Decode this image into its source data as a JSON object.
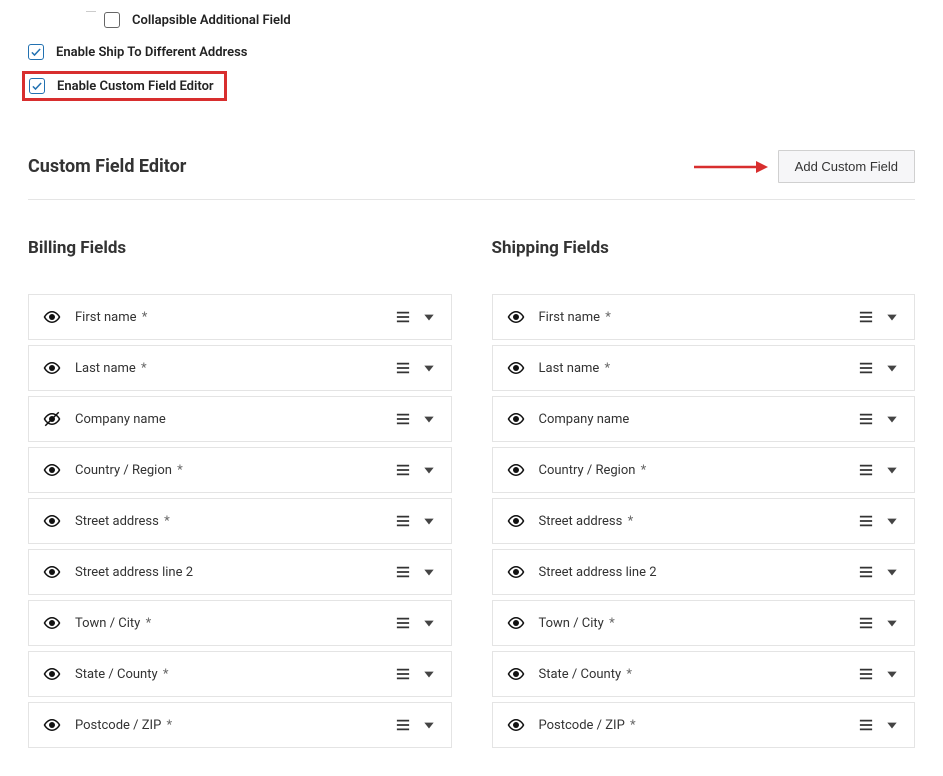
{
  "options": {
    "collapsible": {
      "label": "Collapsible Additional Field",
      "checked": false
    },
    "ship_different": {
      "label": "Enable Ship To Different Address",
      "checked": true
    },
    "custom_editor": {
      "label": "Enable Custom Field Editor",
      "checked": true
    }
  },
  "editor": {
    "title": "Custom Field Editor",
    "add_button": "Add Custom Field"
  },
  "columns": {
    "billing_title": "Billing Fields",
    "shipping_title": "Shipping Fields"
  },
  "billing_fields": [
    {
      "label": "First name",
      "required": true,
      "visible": true
    },
    {
      "label": "Last name",
      "required": true,
      "visible": true
    },
    {
      "label": "Company name",
      "required": false,
      "visible": false
    },
    {
      "label": "Country / Region",
      "required": true,
      "visible": true
    },
    {
      "label": "Street address",
      "required": true,
      "visible": true
    },
    {
      "label": "Street address line 2",
      "required": false,
      "visible": true
    },
    {
      "label": "Town / City",
      "required": true,
      "visible": true
    },
    {
      "label": "State / County",
      "required": true,
      "visible": true
    },
    {
      "label": "Postcode / ZIP",
      "required": true,
      "visible": true
    }
  ],
  "shipping_fields": [
    {
      "label": "First name",
      "required": true,
      "visible": true
    },
    {
      "label": "Last name",
      "required": true,
      "visible": true
    },
    {
      "label": "Company name",
      "required": false,
      "visible": true
    },
    {
      "label": "Country / Region",
      "required": true,
      "visible": true
    },
    {
      "label": "Street address",
      "required": true,
      "visible": true
    },
    {
      "label": "Street address line 2",
      "required": false,
      "visible": true
    },
    {
      "label": "Town / City",
      "required": true,
      "visible": true
    },
    {
      "label": "State / County",
      "required": true,
      "visible": true
    },
    {
      "label": "Postcode / ZIP",
      "required": true,
      "visible": true
    }
  ]
}
